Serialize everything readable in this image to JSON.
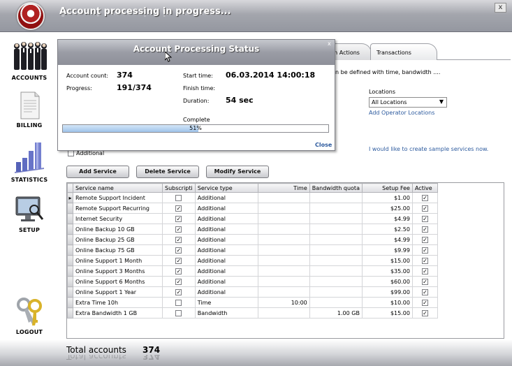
{
  "window": {
    "title": "Account processing in progress...",
    "close_glyph": "x"
  },
  "sidebar": {
    "items": [
      {
        "label": "ACCOUNTS",
        "icon": "people-icon"
      },
      {
        "label": "BILLING",
        "icon": "document-icon"
      },
      {
        "label": "STATISTICS",
        "icon": "bar-chart-icon"
      },
      {
        "label": "SETUP",
        "icon": "monitor-icon"
      },
      {
        "label": "LOGOUT",
        "icon": "keys-icon"
      }
    ]
  },
  "tabs": [
    {
      "label": "th Actions"
    },
    {
      "label": "Transactions"
    }
  ],
  "content": {
    "partial_text": "n be defined with time, bandwidth ....",
    "locations_label": "Locations",
    "locations_selected": "All Locations",
    "add_operator_locations": "Add Operator Locations",
    "sample_services_link": "I would like to create sample services now.",
    "additional_checkbox_label": "Additional"
  },
  "buttons": {
    "add_service": "Add Service",
    "delete_service": "Delete Service",
    "modify_service": "Modify Service"
  },
  "grid": {
    "columns": [
      "Service name",
      "Subscripti",
      "Service type",
      "Time",
      "Bandwidth quota",
      "Setup Fee",
      "Active"
    ],
    "rows": [
      {
        "name": "Remote Support Incident",
        "subscription": false,
        "type": "Additional",
        "time": "",
        "bandwidth": "",
        "fee": "$1.00",
        "active": true
      },
      {
        "name": "Remote Support Recurring",
        "subscription": true,
        "type": "Additional",
        "time": "",
        "bandwidth": "",
        "fee": "$25.00",
        "active": true
      },
      {
        "name": "Internet Security",
        "subscription": true,
        "type": "Additional",
        "time": "",
        "bandwidth": "",
        "fee": "$4.99",
        "active": true
      },
      {
        "name": "Online Backup 10 GB",
        "subscription": true,
        "type": "Additional",
        "time": "",
        "bandwidth": "",
        "fee": "$2.50",
        "active": true
      },
      {
        "name": "Online Backup 25 GB",
        "subscription": true,
        "type": "Additional",
        "time": "",
        "bandwidth": "",
        "fee": "$4.99",
        "active": true
      },
      {
        "name": "Online Backup 75 GB",
        "subscription": true,
        "type": "Additional",
        "time": "",
        "bandwidth": "",
        "fee": "$9.99",
        "active": true
      },
      {
        "name": "Online Support 1 Month",
        "subscription": true,
        "type": "Additional",
        "time": "",
        "bandwidth": "",
        "fee": "$15.00",
        "active": true
      },
      {
        "name": "Online Support 3 Months",
        "subscription": true,
        "type": "Additional",
        "time": "",
        "bandwidth": "",
        "fee": "$35.00",
        "active": true
      },
      {
        "name": "Online Support 6 Months",
        "subscription": true,
        "type": "Additional",
        "time": "",
        "bandwidth": "",
        "fee": "$60.00",
        "active": true
      },
      {
        "name": "Online Support 1 Year",
        "subscription": true,
        "type": "Additional",
        "time": "",
        "bandwidth": "",
        "fee": "$99.00",
        "active": true
      },
      {
        "name": "Extra Time 10h",
        "subscription": false,
        "type": "Time",
        "time": "10:00",
        "bandwidth": "",
        "fee": "$10.00",
        "active": true
      },
      {
        "name": "Extra Bandwidth 1 GB",
        "subscription": false,
        "type": "Bandwidth",
        "time": "",
        "bandwidth": "1.00 GB",
        "fee": "$15.00",
        "active": true
      }
    ]
  },
  "footer": {
    "total_label": "Total accounts",
    "total_value": "374"
  },
  "modal": {
    "title": "Account Processing Status",
    "close_glyph": "x",
    "account_count_label": "Account count:",
    "account_count_value": "374",
    "progress_label": "Progress:",
    "progress_value": "191/374",
    "start_time_label": "Start time:",
    "start_time_value": "06.03.2014 14:00:18",
    "finish_time_label": "Finish time:",
    "duration_label": "Duration:",
    "duration_value": "54 sec",
    "complete_label": "Complete",
    "progress_percent": 51,
    "progress_text": "51%",
    "close_link": "Close"
  }
}
